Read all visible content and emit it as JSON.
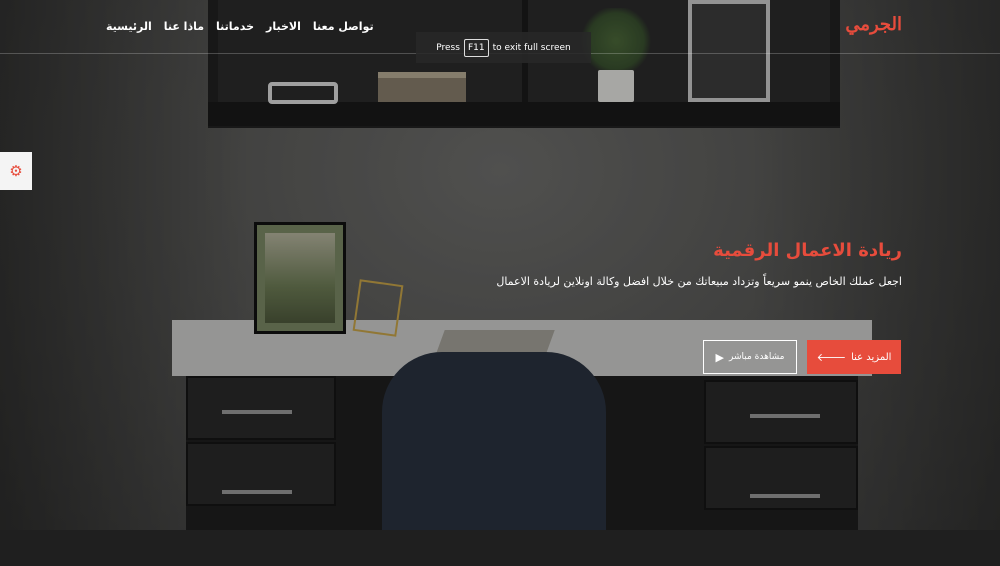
{
  "brand": {
    "logo_text": "الجرمي",
    "accent": "#e74c3c"
  },
  "nav": {
    "items": [
      {
        "label": "الرئيسية"
      },
      {
        "label": "ماذا عنا"
      },
      {
        "label": "خدماتنا"
      },
      {
        "label": "الاخبار"
      },
      {
        "label": "تواصل معنا"
      }
    ]
  },
  "fullscreen_hint": {
    "press": "Press",
    "key": "F11",
    "rest": "to exit full screen"
  },
  "settings": {
    "icon": "gear-icon"
  },
  "hero": {
    "title": "ريادة الاعمال الرقمية",
    "subtitle": "اجعل عملك الخاص ينمو سريعاً وتزداد مبيعاتك من خلال افضل وكالة اونلاين لريادة الاعمال",
    "primary_button": {
      "label": "المزيد عنا",
      "icon": "arrow-left-icon"
    },
    "secondary_button": {
      "label": "مشاهدة مباشر",
      "icon": "play-icon"
    }
  }
}
